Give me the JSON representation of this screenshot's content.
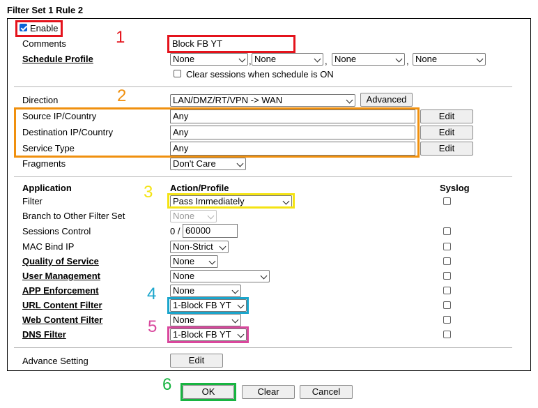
{
  "title": "Filter Set 1 Rule 2",
  "enable": {
    "label": "Enable",
    "checked": true
  },
  "comments": {
    "label": "Comments",
    "value": "Block FB YT"
  },
  "schedule": {
    "label": "Schedule Profile",
    "profiles": [
      "None",
      "None",
      "None",
      "None"
    ],
    "clear_sessions_label": "Clear sessions when schedule is ON"
  },
  "direction": {
    "label": "Direction",
    "value": "LAN/DMZ/RT/VPN -> WAN",
    "advanced_label": "Advanced"
  },
  "source": {
    "label": "Source IP/Country",
    "value": "Any",
    "edit_label": "Edit"
  },
  "destination": {
    "label": "Destination IP/Country",
    "value": "Any",
    "edit_label": "Edit"
  },
  "service": {
    "label": "Service Type",
    "value": "Any",
    "edit_label": "Edit"
  },
  "fragments": {
    "label": "Fragments",
    "value": "Don't Care"
  },
  "headers": {
    "application": "Application",
    "action": "Action/Profile",
    "syslog": "Syslog"
  },
  "apps": {
    "filter": {
      "label": "Filter",
      "value": "Pass Immediately"
    },
    "branch": {
      "label": "Branch to Other Filter Set",
      "value": "None"
    },
    "sessions": {
      "label": "Sessions Control",
      "prefix": "0 /",
      "value": "60000"
    },
    "macbind": {
      "label": "MAC Bind IP",
      "value": "Non-Strict"
    },
    "qos": {
      "label": "Quality of Service",
      "value": "None"
    },
    "user": {
      "label": "User Management",
      "value": "None"
    },
    "app_enf": {
      "label": "APP Enforcement",
      "value": "None"
    },
    "url": {
      "label": "URL Content Filter",
      "value": "1-Block FB YT"
    },
    "web": {
      "label": "Web Content Filter",
      "value": "None"
    },
    "dns": {
      "label": "DNS Filter",
      "value": "1-Block FB YT"
    }
  },
  "advance": {
    "label": "Advance Setting",
    "edit_label": "Edit"
  },
  "footer": {
    "ok": "OK",
    "clear": "Clear",
    "cancel": "Cancel"
  },
  "annotations": {
    "n1": "1",
    "n2": "2",
    "n3": "3",
    "n4": "4",
    "n5": "5",
    "n6": "6"
  },
  "colors": {
    "red": "#e4131c",
    "orange": "#f0900e",
    "yellow": "#f4e313",
    "cyan": "#1aa5cc",
    "magenta": "#d9479d",
    "green": "#18b441"
  }
}
